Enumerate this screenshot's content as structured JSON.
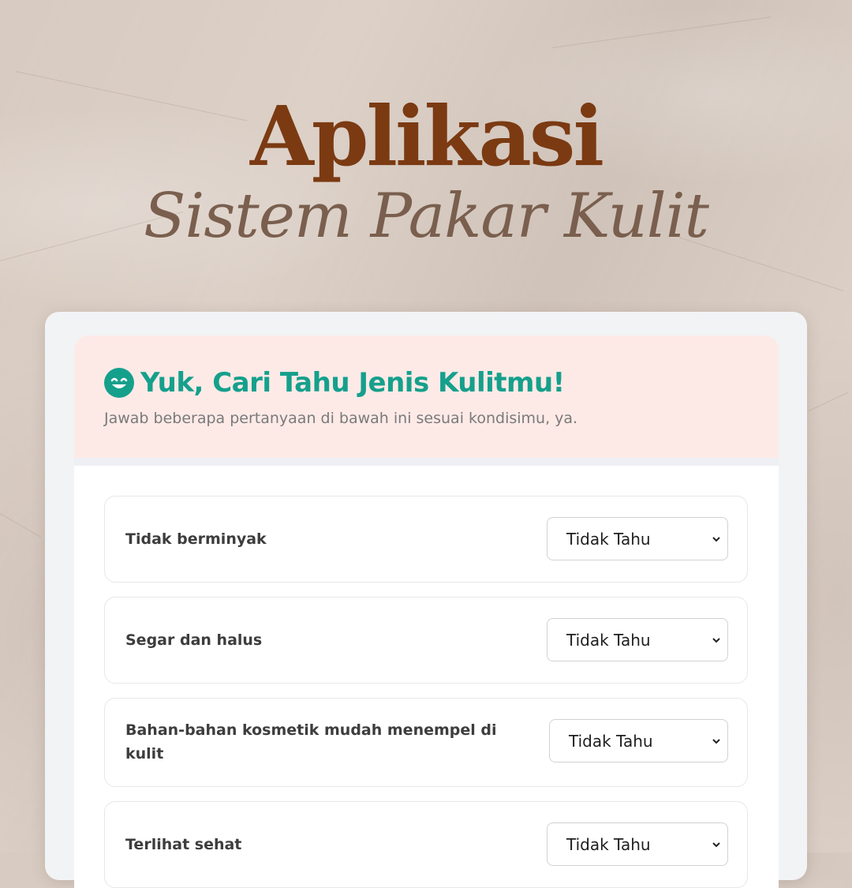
{
  "header": {
    "title": "Aplikasi",
    "subtitle": "Sistem Pakar Kulit"
  },
  "form": {
    "icon": "smile-icon",
    "heading": "Yuk, Cari Tahu Jenis Kulitmu!",
    "description": "Jawab beberapa pertanyaan di bawah ini sesuai kondisimu, ya.",
    "questions": [
      {
        "label": "Tidak berminyak",
        "selected": "Tidak Tahu"
      },
      {
        "label": "Segar dan halus",
        "selected": "Tidak Tahu"
      },
      {
        "label": "Bahan-bahan kosmetik mudah menempel di kulit",
        "selected": "Tidak Tahu"
      },
      {
        "label": "Terlihat sehat",
        "selected": "Tidak Tahu"
      }
    ]
  },
  "colors": {
    "title": "#7b3a12",
    "subtitle": "#7a5f4e",
    "accent": "#15a08c",
    "hero_bg": "#fdeae7",
    "page_bg": "#d8cbc1"
  }
}
